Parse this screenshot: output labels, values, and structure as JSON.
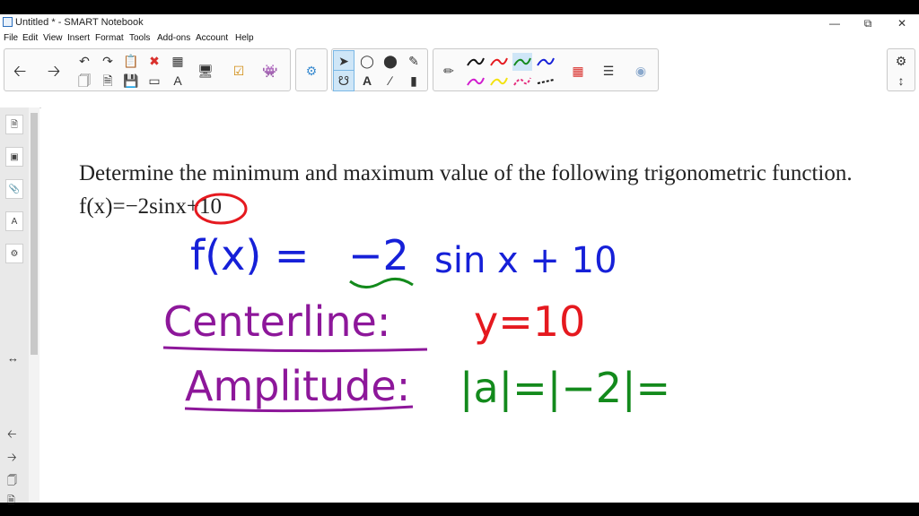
{
  "window": {
    "title": "Untitled * - SMART Notebook"
  },
  "menu": [
    "File",
    "Edit",
    "View",
    "Insert",
    "Format",
    "Tools",
    "Add-ons",
    "Account",
    "Help"
  ],
  "toolbar": {
    "colors": {
      "pen_black": "#111111",
      "pen_red": "#e5191f",
      "pen_green": "#138a1c",
      "pen_blue": "#1620d8",
      "pen_magenta": "#d11ccf",
      "pen_yellow": "#f3e20f",
      "pen_pink": "#e52d7d"
    },
    "icons": [
      "back-icon",
      "forward-icon",
      "undo-icon",
      "redo-icon",
      "table-icon",
      "select-icon",
      "text-icon",
      "eraser-icon",
      "pen-icon",
      "settings-icon"
    ]
  },
  "canvas": {
    "question": "Determine the minimum and maximum value of the following trigonometric function.",
    "function": "f(x)=−2sinx+10",
    "hand_func_lhs": "f(x) =",
    "hand_func_coef": "−2",
    "hand_func_rhs": "sin x + 10",
    "centerline_label": "Centerline:",
    "centerline_value": "y=10",
    "amplitude_label": "Amplitude:",
    "amplitude_value": "|a|=|−2|="
  }
}
